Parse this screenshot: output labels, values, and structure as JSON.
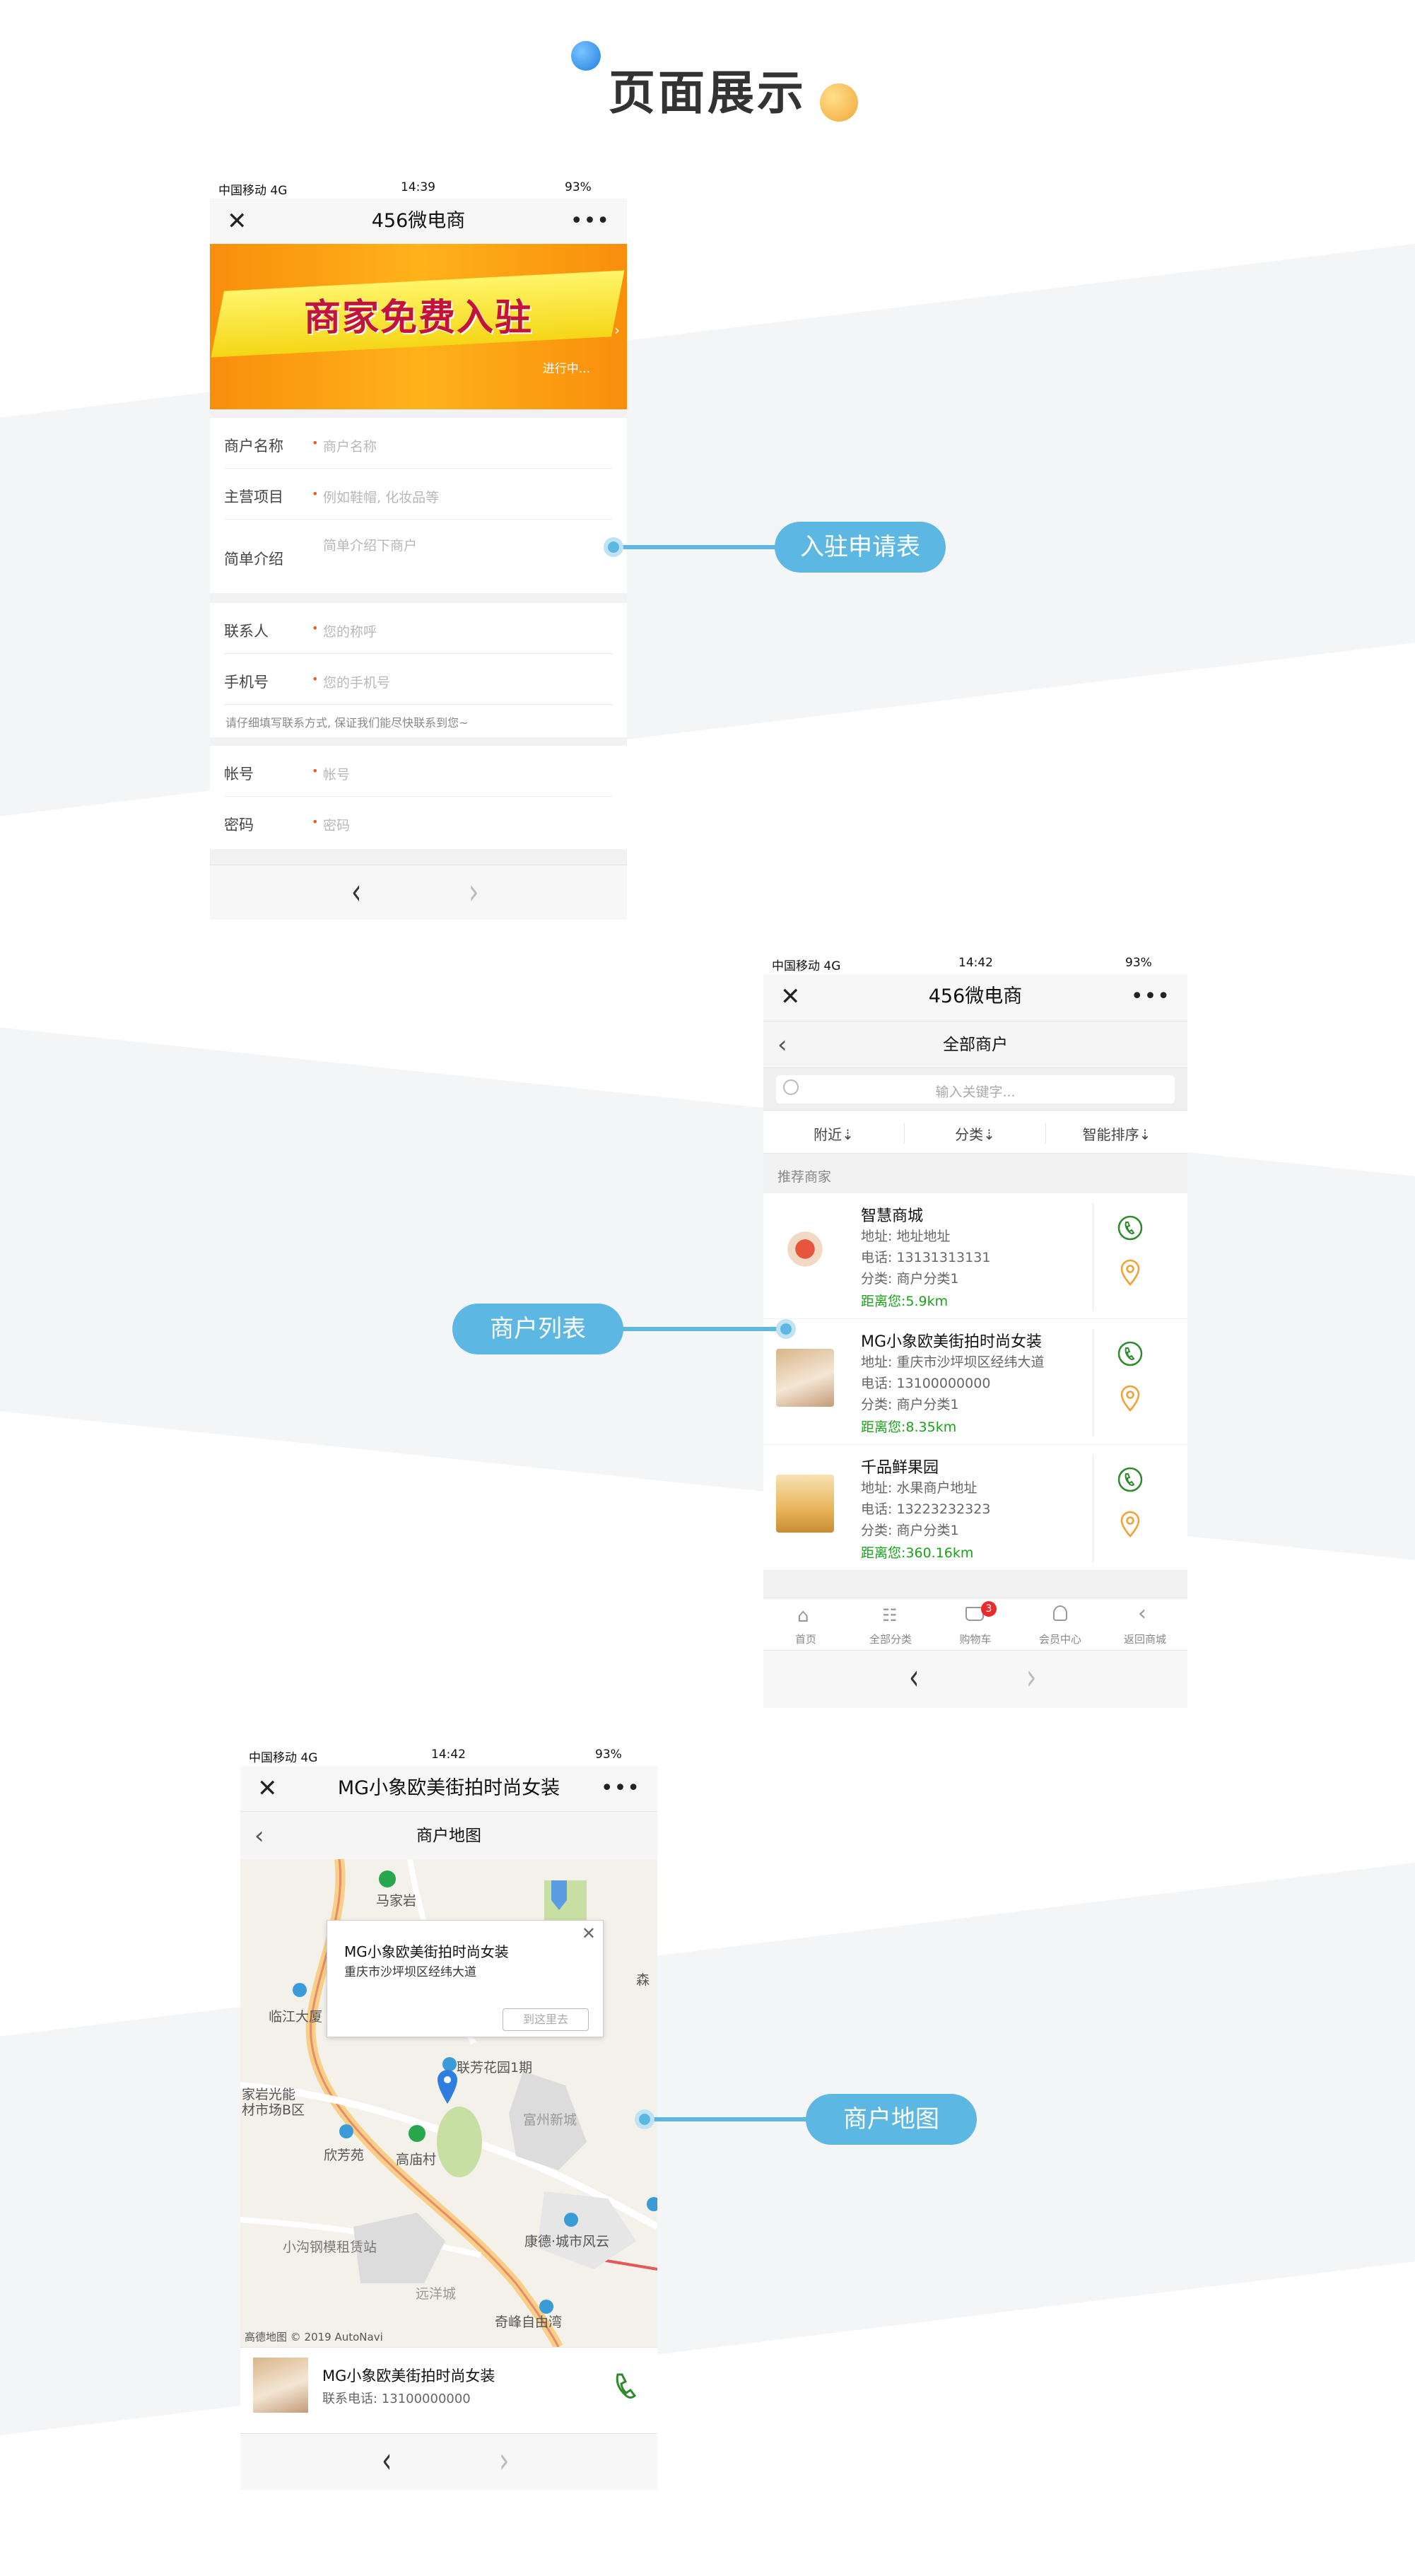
{
  "header": {
    "title": "页面展示",
    "accent_blue": "#3a8ee6",
    "accent_orange": "#f6b93b"
  },
  "callouts": {
    "application_form": "入驻申请表",
    "merchant_list": "商户列表",
    "merchant_map": "商户地图",
    "color": "#5cb7e3"
  },
  "screen1": {
    "status": {
      "carrier": "中国移动 4G",
      "time": "14:39",
      "battery": "93%"
    },
    "navbar": {
      "title": "456微电商"
    },
    "banner": {
      "headline": "商家免费入驻",
      "status": "进行中..."
    },
    "form": {
      "merchant_name": {
        "label": "商户名称",
        "placeholder": "商户名称"
      },
      "main_business": {
        "label": "主营项目",
        "placeholder": "例如鞋帽, 化妆品等"
      },
      "intro": {
        "label": "简单介绍",
        "placeholder": "简单介绍下商户"
      },
      "contact": {
        "label": "联系人",
        "placeholder": "您的称呼"
      },
      "mobile": {
        "label": "手机号",
        "placeholder": "您的手机号"
      },
      "tip": "请仔细填写联系方式, 保证我们能尽快联系到您~",
      "account": {
        "label": "帐号",
        "placeholder": "帐号"
      },
      "password": {
        "label": "密码",
        "placeholder": "密码"
      }
    }
  },
  "screen2": {
    "status": {
      "carrier": "中国移动 4G",
      "time": "14:42",
      "battery": "93%"
    },
    "navbar": {
      "title": "456微电商"
    },
    "subheader": {
      "title": "全部商户"
    },
    "search": {
      "placeholder": "输入关键字..."
    },
    "filters": [
      "附近⇣",
      "分类⇣",
      "智能排序⇣"
    ],
    "section_title": "推荐商家",
    "merchants": [
      {
        "name": "智慧商城",
        "address": "地址: 地址地址",
        "phone": "电话: 13131313131",
        "category": "分类: 商户分类1",
        "distance": "距离您:5.9km"
      },
      {
        "name": "MG小象欧美街拍时尚女装",
        "address": "地址: 重庆市沙坪坝区经纬大道",
        "phone": "电话: 13100000000",
        "category": "分类: 商户分类1",
        "distance": "距离您:8.35km"
      },
      {
        "name": "千品鲜果园",
        "address": "地址: 水果商户地址",
        "phone": "电话: 13223232323",
        "category": "分类: 商户分类1",
        "distance": "距离您:360.16km"
      }
    ],
    "tabbar": [
      {
        "label": "首页",
        "icon": "home-icon"
      },
      {
        "label": "全部分类",
        "icon": "category-icon"
      },
      {
        "label": "购物车",
        "icon": "cart-icon",
        "badge": "3"
      },
      {
        "label": "会员中心",
        "icon": "user-icon"
      },
      {
        "label": "返回商城",
        "icon": "back-icon"
      }
    ]
  },
  "screen3": {
    "status": {
      "carrier": "中国移动 4G",
      "time": "14:42",
      "battery": "93%"
    },
    "navbar": {
      "title": "MG小象欧美街拍时尚女装"
    },
    "subheader": {
      "title": "商户地图"
    },
    "popup": {
      "name": "MG小象欧美街拍时尚女装",
      "address": "重庆市沙坪坝区经纬大道",
      "button": "到这里去"
    },
    "map_labels": [
      "马家岩",
      "临江大厦",
      "联芳花园1期",
      "家岩光能",
      "材市场B区",
      "欣芳苑",
      "高庙村",
      "富州新城",
      "康德·城市风云",
      "小沟钢模租赁站",
      "远洋城",
      "奇峰自由湾",
      "森"
    ],
    "attribution": "高德地图 © 2019 AutoNavi",
    "footer": {
      "name": "MG小象欧美街拍时尚女装",
      "phone": "联系电话: 13100000000"
    }
  }
}
